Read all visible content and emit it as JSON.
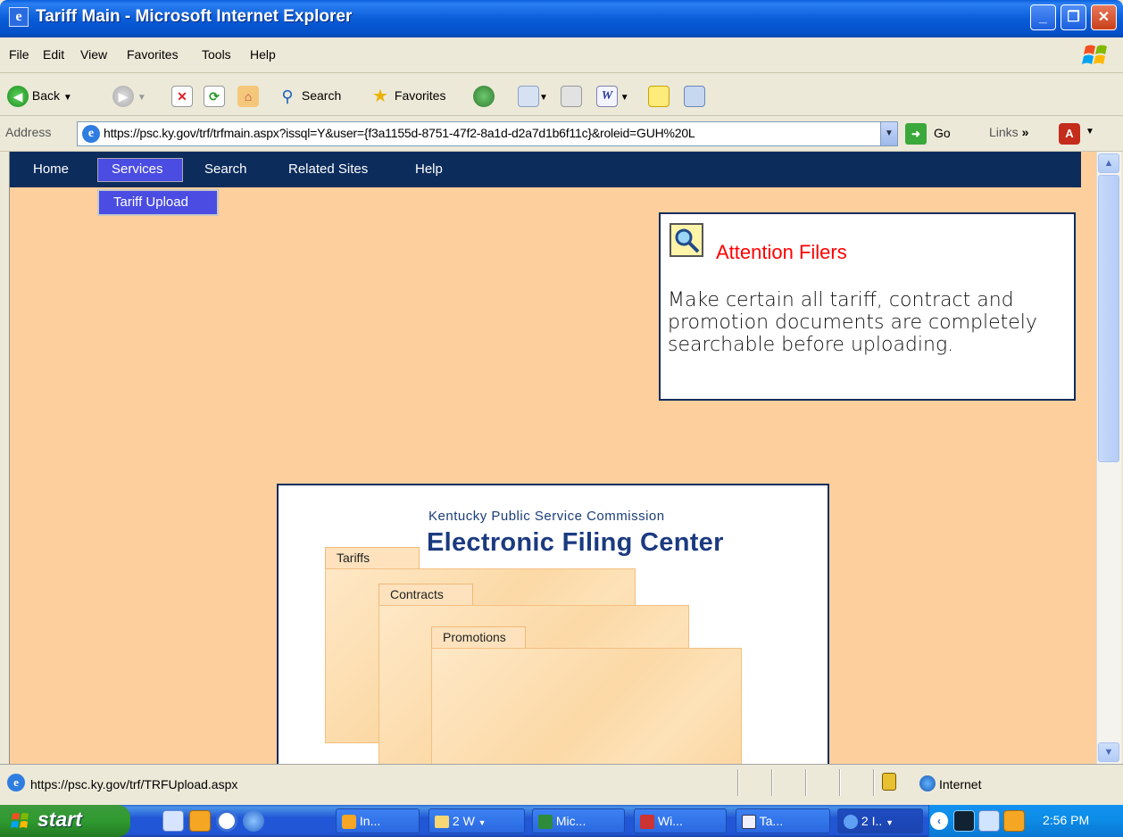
{
  "window": {
    "title": "Tariff Main - Microsoft Internet Explorer"
  },
  "menubar": {
    "items": [
      "File",
      "Edit",
      "View",
      "Favorites",
      "Tools",
      "Help"
    ]
  },
  "toolbar": {
    "back_label": "Back",
    "search_label": "Search",
    "favorites_label": "Favorites"
  },
  "addressbar": {
    "label": "Address",
    "url": "https://psc.ky.gov/trf/trfmain.aspx?issql=Y&user={f3a1155d-8751-47f2-8a1d-d2a7d1b6f11c}&roleid=GUH%20L",
    "go_label": "Go",
    "links_label": "Links"
  },
  "site_nav": {
    "items": [
      "Home",
      "Services",
      "Search",
      "Related Sites",
      "Help"
    ],
    "submenu_item": "Tariff Upload"
  },
  "attention": {
    "heading": "Attention Filers",
    "body": "Make certain all tariff, contract and promotion documents are completely searchable before uploading."
  },
  "filing_center": {
    "org": "Kentucky Public Service Commission",
    "title": "Electronic Filing Center",
    "tabs": [
      "Tariffs",
      "Contracts",
      "Promotions"
    ]
  },
  "statusbar": {
    "url": "https://psc.ky.gov/trf/TRFUpload.aspx",
    "zone": "Internet"
  },
  "taskbar": {
    "start_label": "start",
    "tasks": [
      "In...",
      "2 W",
      "Mic...",
      "Wi...",
      "Ta...",
      "2 I.."
    ],
    "clock": "2:56 PM"
  }
}
